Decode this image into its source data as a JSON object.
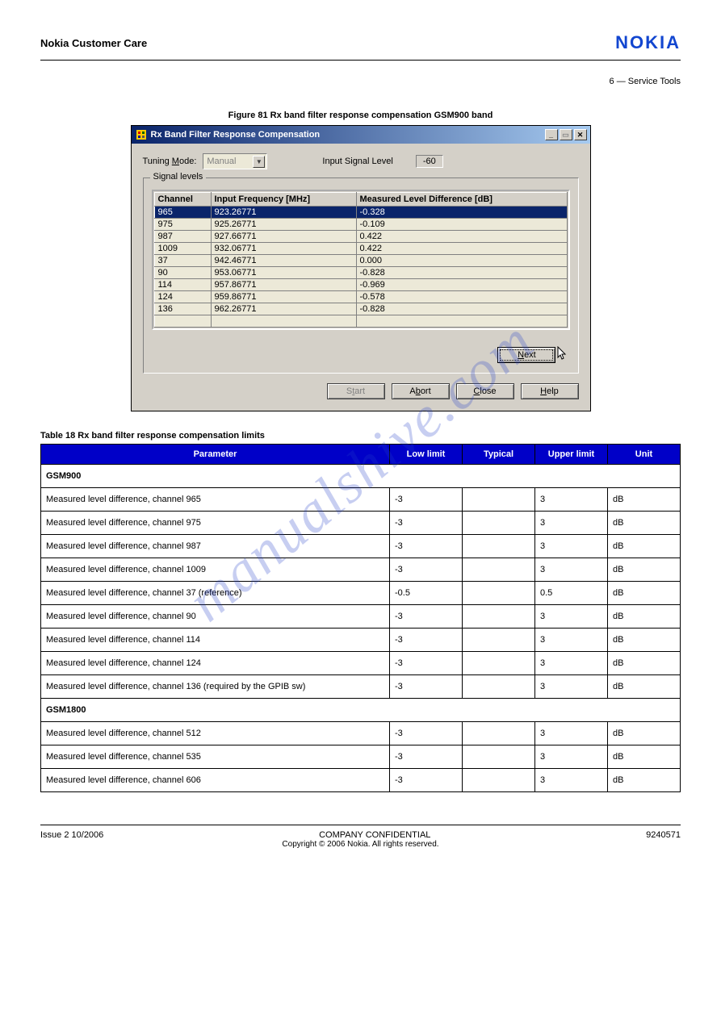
{
  "watermark": "manualshive.com",
  "header": {
    "doc_title": "Nokia Customer Care",
    "brand": "NOKIA",
    "subhead": "6 — Service Tools"
  },
  "figure": {
    "dialog_label": "Figure 81 Rx band filter response compensation GSM900 band",
    "window_title": "Rx Band Filter Response Compensation",
    "tuning_mode_label_pre": "Tuning ",
    "tuning_mode_label_u": "M",
    "tuning_mode_label_post": "ode:",
    "tuning_mode_value": "Manual",
    "input_signal_label": "Input Signal Level",
    "input_signal_value": "-60",
    "group_label": "Signal levels",
    "table_headers": [
      "Channel",
      "Input Frequency [MHz]",
      "Measured Level Difference [dB]"
    ],
    "rows": [
      {
        "channel": "965",
        "freq": "923.26771",
        "diff": "-0.328",
        "selected": true
      },
      {
        "channel": "975",
        "freq": "925.26771",
        "diff": "-0.109"
      },
      {
        "channel": "987",
        "freq": "927.66771",
        "diff": "0.422"
      },
      {
        "channel": "1009",
        "freq": "932.06771",
        "diff": "0.422"
      },
      {
        "channel": "37",
        "freq": "942.46771",
        "diff": "0.000"
      },
      {
        "channel": "90",
        "freq": "953.06771",
        "diff": "-0.828"
      },
      {
        "channel": "114",
        "freq": "957.86771",
        "diff": "-0.969"
      },
      {
        "channel": "124",
        "freq": "959.86771",
        "diff": "-0.578"
      },
      {
        "channel": "136",
        "freq": "962.26771",
        "diff": "-0.828"
      }
    ],
    "btn_next_u": "N",
    "btn_next_rest": "ext",
    "btn_start_pre": "S",
    "btn_start_u": "t",
    "btn_start_post": "art",
    "btn_abort_pre": "A",
    "btn_abort_u": "b",
    "btn_abort_post": "ort",
    "btn_close_u": "C",
    "btn_close_rest": "lose",
    "btn_help_u": "H",
    "btn_help_rest": "elp"
  },
  "spec": {
    "caption": "Table 18 Rx band filter response compensation limits",
    "headers": [
      "Parameter",
      "Low limit",
      "Typical",
      "Upper limit",
      "Unit"
    ],
    "section_a": "GSM900",
    "rows_a": [
      [
        "Measured level difference, channel 965",
        "-3",
        "",
        "3",
        "dB"
      ],
      [
        "Measured level difference, channel 975",
        "-3",
        "",
        "3",
        "dB"
      ],
      [
        "Measured level difference, channel 987",
        "-3",
        "",
        "3",
        "dB"
      ],
      [
        "Measured level difference, channel 1009",
        "-3",
        "",
        "3",
        "dB"
      ],
      [
        "Measured level difference, channel 37 (reference)",
        "-0.5",
        "",
        "0.5",
        "dB"
      ],
      [
        "Measured level difference, channel 90",
        "-3",
        "",
        "3",
        "dB"
      ],
      [
        "Measured level difference, channel 114",
        "-3",
        "",
        "3",
        "dB"
      ],
      [
        "Measured level difference, channel 124",
        "-3",
        "",
        "3",
        "dB"
      ],
      [
        "Measured level difference, channel 136 (required by the GPIB sw)",
        "-3",
        "",
        "3",
        "dB"
      ]
    ],
    "section_b": "GSM1800",
    "rows_b": [
      [
        "Measured level difference, channel 512",
        "-3",
        "",
        "3",
        "dB"
      ],
      [
        "Measured level difference, channel 535",
        "-3",
        "",
        "3",
        "dB"
      ],
      [
        "Measured level difference, channel 606",
        "-3",
        "",
        "3",
        "dB"
      ]
    ]
  },
  "footer": {
    "left": "Issue 2   10/2006",
    "center": "COMPANY CONFIDENTIAL",
    "right": "9240571",
    "copyright": "Copyright © 2006 Nokia. All rights reserved."
  }
}
